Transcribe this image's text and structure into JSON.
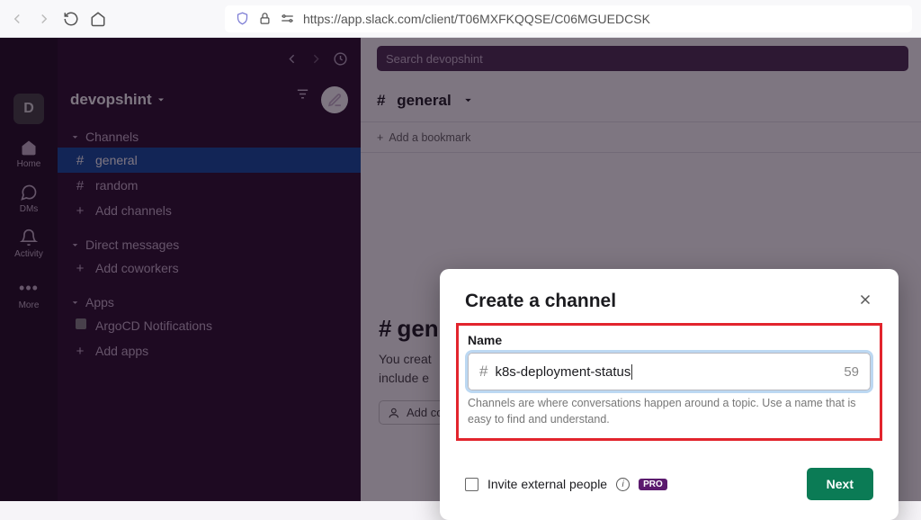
{
  "browser": {
    "url": "https://app.slack.com/client/T06MXFKQQSE/C06MGUEDCSK"
  },
  "search": {
    "placeholder": "Search devopshint"
  },
  "workspace": {
    "initial": "D",
    "name": "devopshint"
  },
  "rail": {
    "home": "Home",
    "dms": "DMs",
    "activity": "Activity",
    "more": "More"
  },
  "sidebar": {
    "channels_label": "Channels",
    "channels": [
      {
        "pre": "#",
        "label": "general"
      },
      {
        "pre": "#",
        "label": "random"
      },
      {
        "pre": "+",
        "label": "Add channels"
      }
    ],
    "dm_label": "Direct messages",
    "dm_add": "Add coworkers",
    "apps_label": "Apps",
    "apps": [
      {
        "label": "ArgoCD Notifications"
      },
      {
        "label": "Add apps"
      }
    ]
  },
  "channel": {
    "name": "general",
    "bookmark": "Add a bookmark",
    "big_title": "gen",
    "desc1": "You creat",
    "desc2": "include e",
    "add_co": "Add co"
  },
  "modal": {
    "title": "Create a channel",
    "name_label": "Name",
    "value": "k8s-deployment-status",
    "remaining": "59",
    "helper": "Channels are where conversations happen around a topic. Use a name that is easy to find and understand.",
    "invite_label": "Invite external people",
    "pro": "PRO",
    "next": "Next"
  }
}
